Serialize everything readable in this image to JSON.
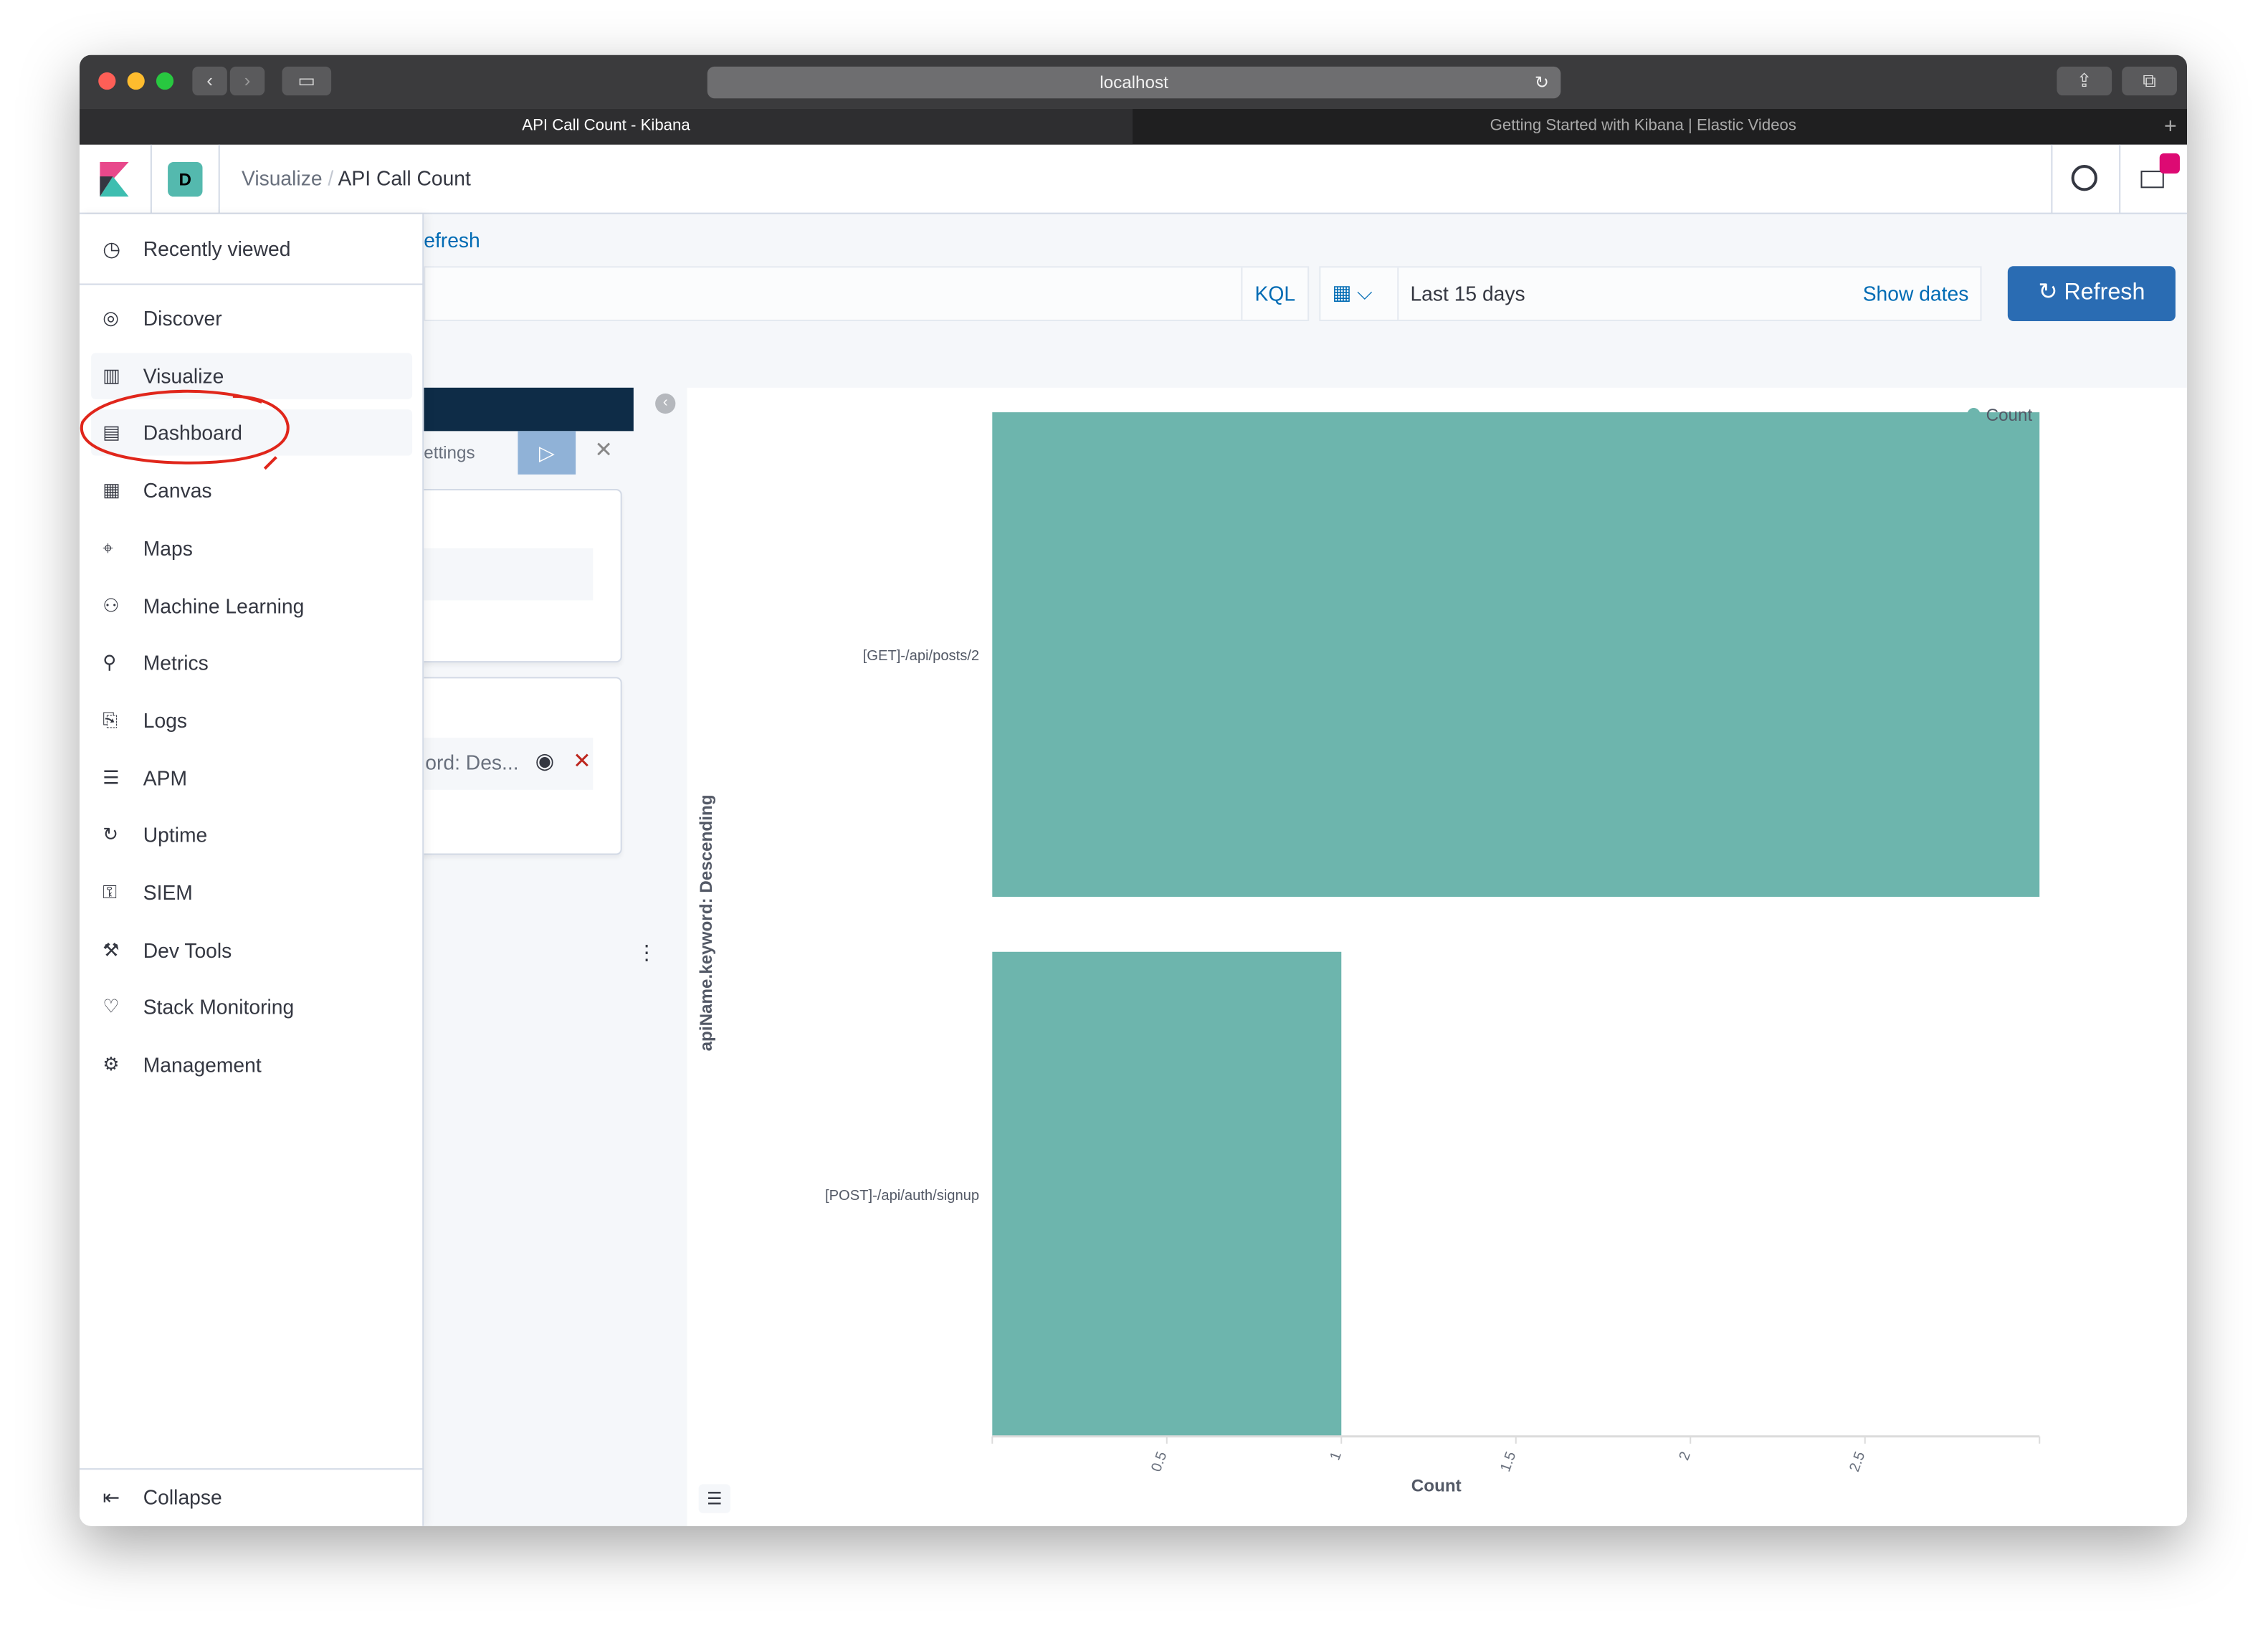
{
  "browser": {
    "url": "localhost",
    "tabs": [
      {
        "label": "API Call Count - Kibana",
        "active": true
      },
      {
        "label": "Getting Started with Kibana | Elastic Videos",
        "active": false
      }
    ]
  },
  "header": {
    "space_avatar": "D",
    "breadcrumbs": [
      "Visualize",
      "API Call Count"
    ],
    "icons": [
      "help-icon",
      "mail-icon"
    ]
  },
  "sidebar": {
    "recent": "Recently viewed",
    "items": [
      {
        "label": "Discover",
        "icon": "compass-icon"
      },
      {
        "label": "Visualize",
        "icon": "visualize-icon"
      },
      {
        "label": "Dashboard",
        "icon": "dashboard-icon"
      },
      {
        "label": "Canvas",
        "icon": "canvas-icon"
      },
      {
        "label": "Maps",
        "icon": "maps-icon"
      },
      {
        "label": "Machine Learning",
        "icon": "ml-icon"
      },
      {
        "label": "Metrics",
        "icon": "metrics-icon"
      },
      {
        "label": "Logs",
        "icon": "logs-icon"
      },
      {
        "label": "APM",
        "icon": "apm-icon"
      },
      {
        "label": "Uptime",
        "icon": "uptime-icon"
      },
      {
        "label": "SIEM",
        "icon": "siem-icon"
      },
      {
        "label": "Dev Tools",
        "icon": "devtools-icon"
      },
      {
        "label": "Stack Monitoring",
        "icon": "monitoring-icon"
      },
      {
        "label": "Management",
        "icon": "gear-icon"
      }
    ],
    "collapse": "Collapse"
  },
  "toolbar": {
    "refresh_link": "efresh",
    "kql": "KQL",
    "date_range": "Last 15 days",
    "show_dates": "Show dates",
    "refresh": "Refresh"
  },
  "editor": {
    "settings_tab": "ettings",
    "bucket_label": "ord: Des..."
  },
  "colors": {
    "bar": "#6db5ad",
    "primary": "#006bb4",
    "annotation": "#e0261b"
  },
  "chart_data": {
    "type": "bar",
    "orientation": "horizontal",
    "categories": [
      "[GET]-/api/posts/2",
      "[POST]-/api/auth/signup"
    ],
    "values": [
      3,
      1
    ],
    "xlabel": "Count",
    "ylabel": "apiName.keyword: Descending",
    "xlim": [
      0,
      3
    ],
    "xticks": [
      "0.5",
      "1",
      "1.5",
      "2",
      "2.5"
    ],
    "legend": {
      "entries": [
        "Count"
      ],
      "placement": "top-right"
    }
  }
}
